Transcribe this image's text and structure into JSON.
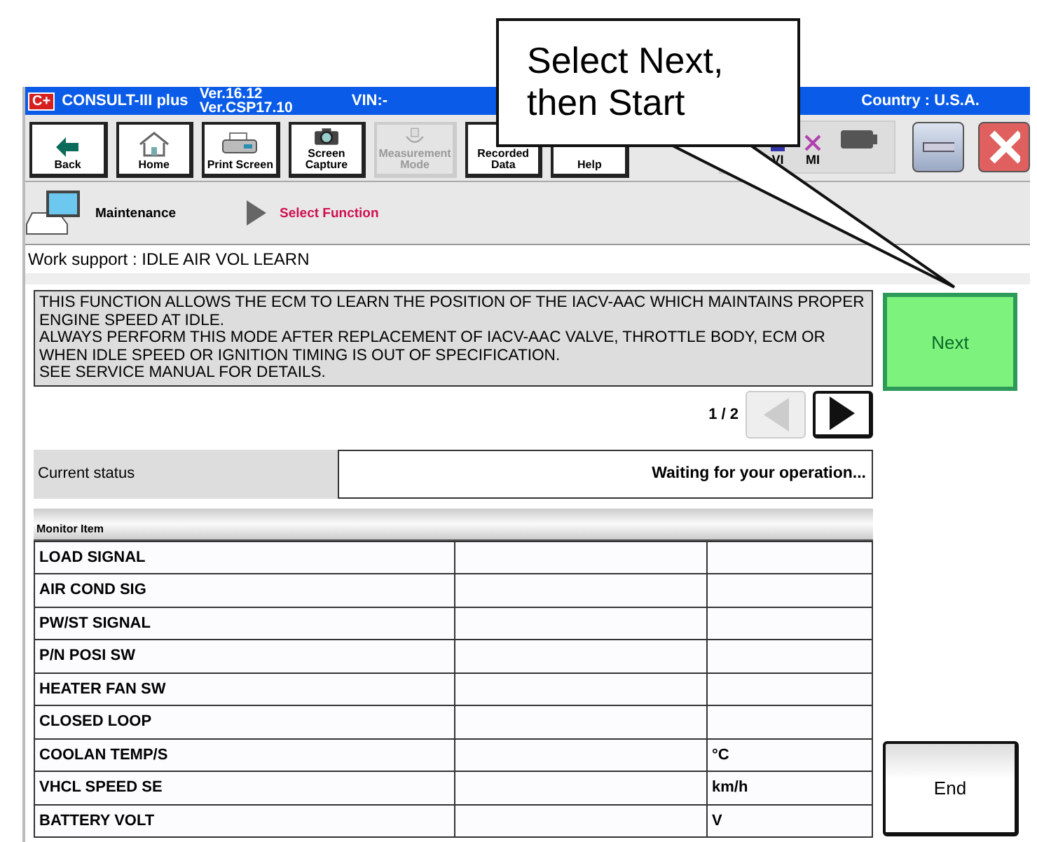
{
  "window": {
    "logo": "C+",
    "app_name": "CONSULT-III plus",
    "version_lines": [
      "Ver.16.12",
      "Ver.CSP17.10"
    ],
    "vin": "VIN:-",
    "country": "Country : U.S.A."
  },
  "toolbar": [
    {
      "label": "Back",
      "kind": "back",
      "disabled": false
    },
    {
      "label": "Home",
      "kind": "home",
      "disabled": false
    },
    {
      "label": "Print Screen",
      "kind": "printer",
      "disabled": false
    },
    {
      "label": "Screen Capture",
      "kind": "camera",
      "disabled": false
    },
    {
      "label": "Measurement Mode",
      "kind": "meter",
      "disabled": true
    },
    {
      "label": "Recorded Data",
      "kind": "none",
      "disabled": false
    },
    {
      "label": "Help",
      "kind": "none",
      "disabled": false
    }
  ],
  "indicators": [
    {
      "label": "VI",
      "kind": "vi"
    },
    {
      "label": "MI",
      "kind": "mi"
    }
  ],
  "breadcrumb": {
    "home": "Maintenance",
    "current": "Select Function"
  },
  "work_support": "Work support : IDLE AIR VOL LEARN",
  "description": [
    "THIS FUNCTION ALLOWS THE ECM TO LEARN THE POSITION OF THE IACV-AAC WHICH MAINTAINS PROPER ENGINE SPEED AT IDLE.",
    "ALWAYS PERFORM THIS MODE AFTER REPLACEMENT OF IACV-AAC VALVE, THROTTLE BODY, ECM OR WHEN IDLE SPEED OR IGNITION TIMING IS OUT OF SPECIFICATION.",
    "SEE SERVICE MANUAL FOR DETAILS."
  ],
  "pager": {
    "text": "1 / 2",
    "prev_disabled": true,
    "next_disabled": false
  },
  "status": {
    "label": "Current status",
    "value": "Waiting for your operation..."
  },
  "table": {
    "header": "Monitor Item",
    "rows": [
      {
        "item": "LOAD SIGNAL",
        "unit": ""
      },
      {
        "item": "AIR COND SIG",
        "unit": ""
      },
      {
        "item": "PW/ST SIGNAL",
        "unit": ""
      },
      {
        "item": "P/N POSI SW",
        "unit": ""
      },
      {
        "item": "HEATER FAN SW",
        "unit": ""
      },
      {
        "item": "CLOSED LOOP",
        "unit": ""
      },
      {
        "item": "COOLAN TEMP/S",
        "unit": "°C"
      },
      {
        "item": "VHCL SPEED SE",
        "unit": "km/h"
      },
      {
        "item": "BATTERY VOLT",
        "unit": "V"
      }
    ]
  },
  "buttons": {
    "next": "Next",
    "end": "End"
  },
  "callout": {
    "lines": [
      "Select Next,",
      "then Start"
    ]
  }
}
